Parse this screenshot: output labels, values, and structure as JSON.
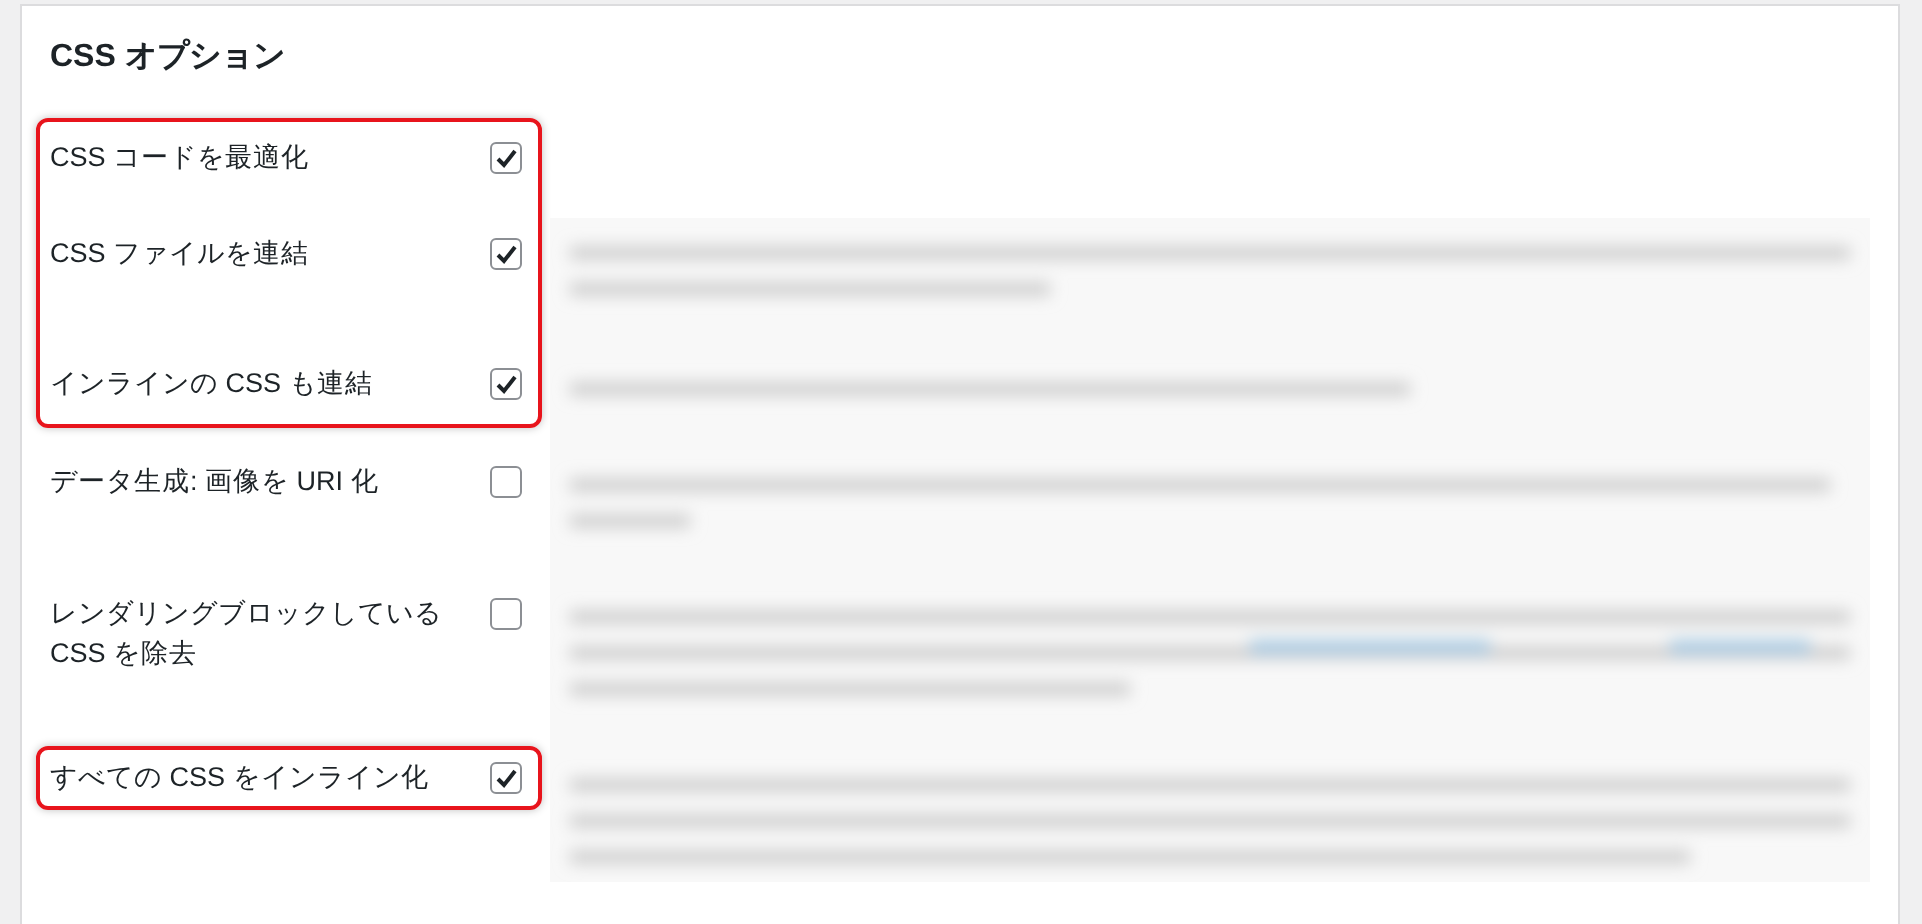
{
  "panel": {
    "title": "CSS オプション"
  },
  "groups": [
    {
      "highlighted": true,
      "options": [
        {
          "label": "CSS コードを最適化",
          "checked": true
        },
        {
          "label": "CSS ファイルを連結",
          "checked": true
        },
        {
          "label": "インラインの CSS も連結",
          "checked": true
        }
      ]
    },
    {
      "highlighted": false,
      "options": [
        {
          "label": "データ生成: 画像を URI 化",
          "checked": false
        },
        {
          "label": "レンダリングブロックしている CSS を除去",
          "checked": false
        }
      ]
    },
    {
      "highlighted": true,
      "options": [
        {
          "label": "すべての CSS をインライン化",
          "checked": true
        }
      ]
    }
  ]
}
